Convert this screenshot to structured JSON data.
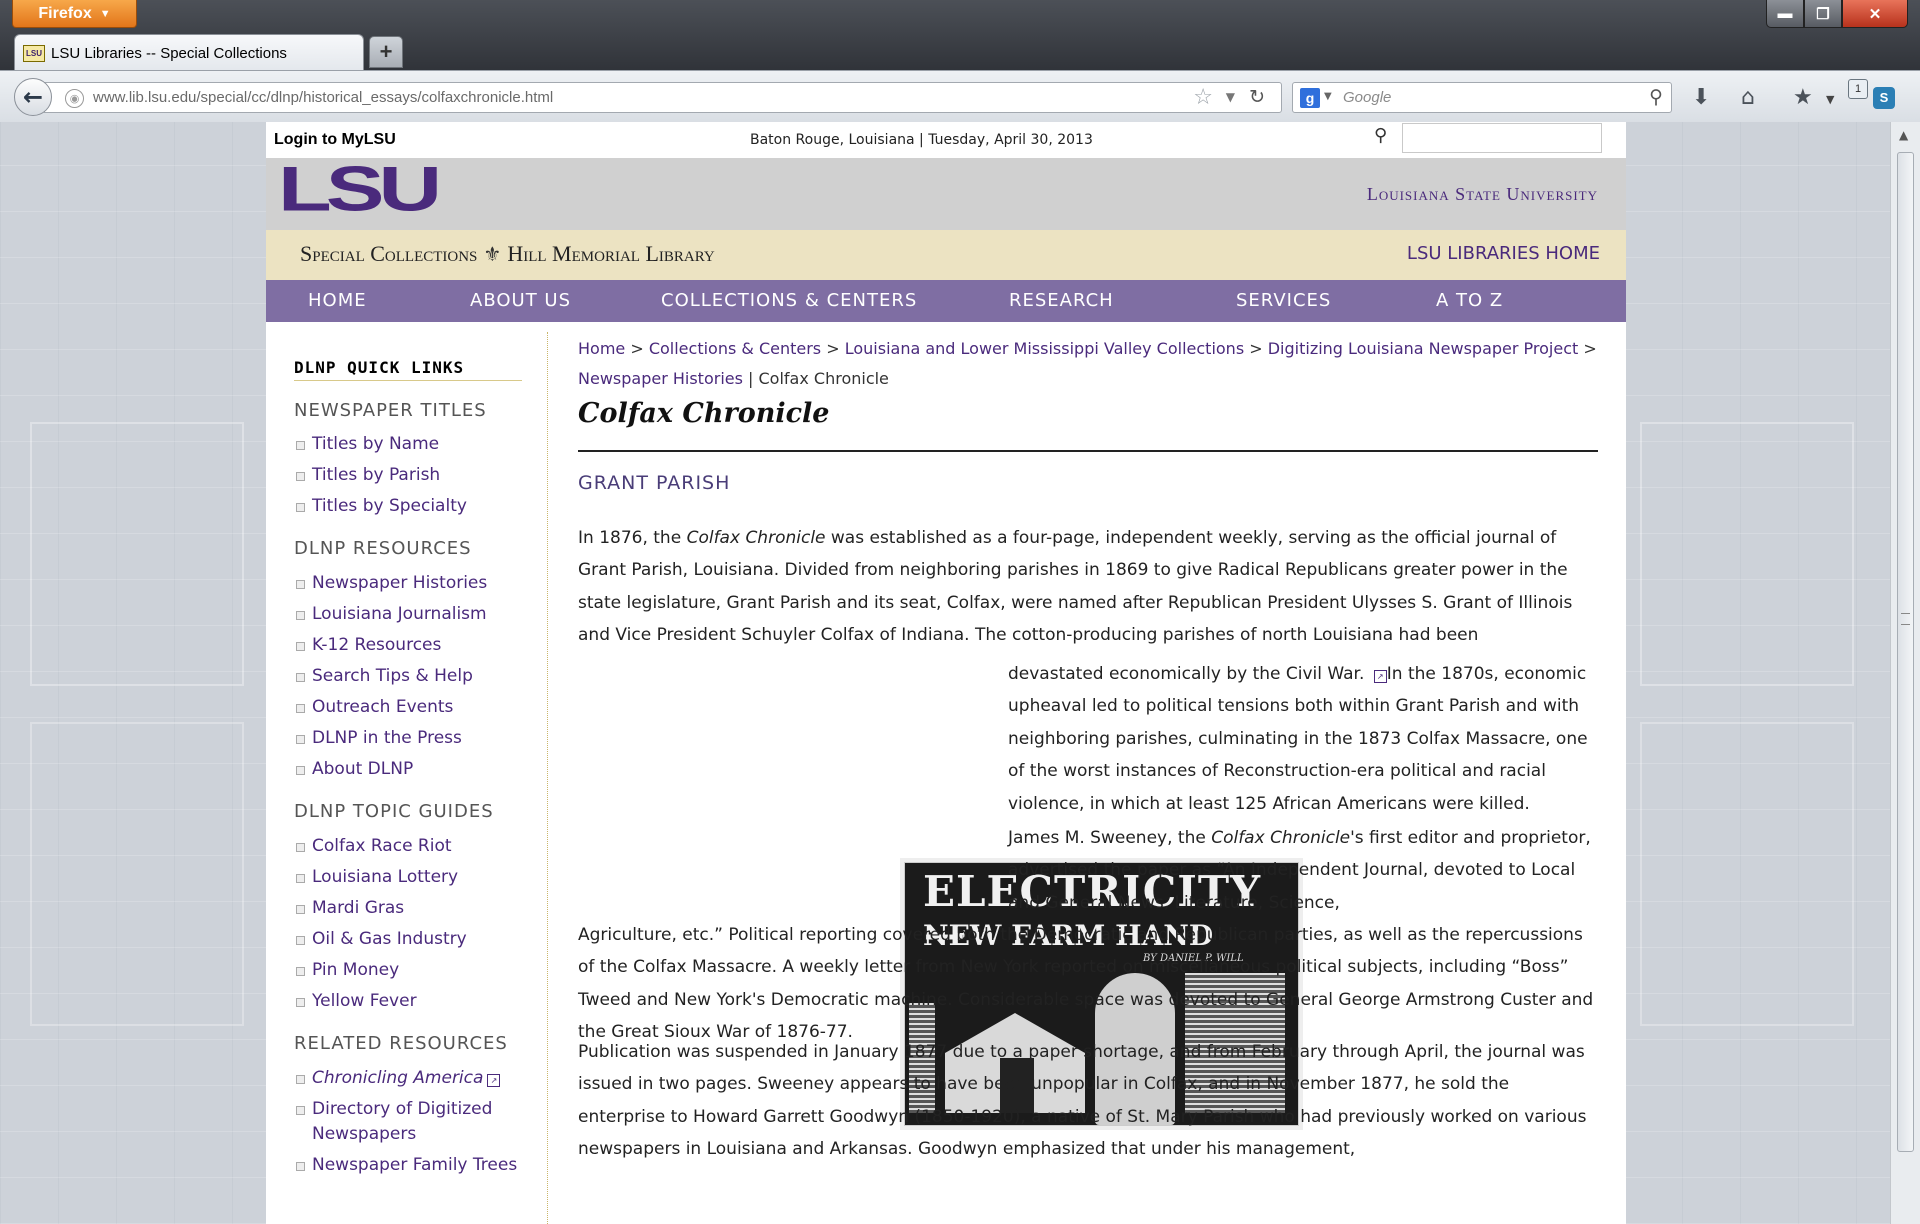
{
  "browser": {
    "menu_button": "Firefox",
    "tab_title": "LSU Libraries -- Special Collections",
    "tab_favicon": "LSU",
    "new_tab": "+",
    "url": "www.lib.lsu.edu/special/cc/dlnp/historical_essays/colfaxchronicle.html",
    "search_engine": "g",
    "search_placeholder": "Google",
    "addon_badge": "1",
    "addon_label": "S"
  },
  "header": {
    "login": "Login to MyLSU",
    "dateline": "Baton Rouge, Louisiana | Tuesday, April 30, 2013",
    "logo": "LSU",
    "university": "Louisiana State University",
    "special_collections": "Special Collections",
    "library_name": "Hill Memorial Library",
    "libraries_home": "LSU LIBRARIES HOME",
    "brand_color": "#4a2a7c",
    "nav_color": "#7f6ea3"
  },
  "nav": [
    "HOME",
    "ABOUT US",
    "COLLECTIONS & CENTERS",
    "RESEARCH",
    "SERVICES",
    "A TO Z"
  ],
  "sidebar": {
    "quick_links": "DLNP QUICK LINKS",
    "newspaper_titles": {
      "heading": "NEWSPAPER TITLES",
      "items": [
        "Titles by Name",
        "Titles by Parish",
        "Titles by Specialty"
      ]
    },
    "resources": {
      "heading": "DLNP RESOURCES",
      "items": [
        "Newspaper Histories",
        "Louisiana Journalism",
        "K-12 Resources",
        "Search Tips & Help",
        "Outreach Events",
        "DLNP in the Press",
        "About DLNP"
      ]
    },
    "topic_guides": {
      "heading": "DLNP TOPIC GUIDES",
      "items": [
        "Colfax Race Riot",
        "Louisiana Lottery",
        "Mardi Gras",
        "Oil & Gas Industry",
        "Pin Money",
        "Yellow Fever"
      ]
    },
    "related": {
      "heading": "RELATED RESOURCES",
      "items": [
        "Chronicling America",
        "Directory of Digitized Newspapers",
        "Newspaper Family Trees"
      ]
    }
  },
  "breadcrumb": {
    "items": [
      "Home",
      "Collections & Centers",
      "Louisiana and Lower Mississippi Valley Collections",
      "Digitizing Louisiana Newspaper Project",
      "Newspaper Histories"
    ],
    "current": "Colfax Chronicle"
  },
  "article": {
    "title": "Colfax Chronicle",
    "parish": "GRANT PARISH",
    "p1_a": "In 1876, the ",
    "p1_em": "Colfax Chronicle",
    "p1_b": " was established as a four-page, independent weekly, serving as the official journal of Grant Parish, Louisiana. Divided from neighboring parishes in 1869 to give Radical Republicans greater power in the state legislature, Grant Parish and its seat, Colfax, were named after Republican President Ulysses S. Grant of Illinois and Vice President Schuyler Colfax of Indiana. The cotton-producing parishes of north Louisiana had been",
    "p1_c": "devastated economically by the Civil War.",
    "p1_d": "In the 1870s, economic upheaval led to political tensions both within Grant Parish and with neighboring parishes, culminating in the 1873 Colfax Massacre, one of the worst instances of Reconstruction-era political and racial violence, in which at least 125 African Americans were killed.",
    "p2_a": "James M. Sweeney, the ",
    "p2_em": "Colfax Chronicle",
    "p2_b": "'s first editor and proprietor, advertised the paper as “An Independent Journal, devoted to Local and General News, Literature, Science,",
    "p2_c": "Agriculture, etc.” Political reporting covered both the Democratic and Republican parties, as well as the repercussions of the Colfax Massacre. A weekly letter from New York reported on miscellaneous political subjects, including “Boss” Tweed and New York's Democratic machine. Considerable space was devoted to General George Armstrong Custer and the Great Sioux War of 1876-77.",
    "p3": "Publication was suspended in January 1877 due to a paper shortage, and from February through April, the journal was issued in two pages. Sweeney appears to have been unpopular in Colfax, and in November 1877, he sold the enterprise to Howard Garrett Goodwyn (1850-1920), a native of St. Mary Parish who had previously worked on various newspapers in Louisiana and Arkansas. Goodwyn emphasized that under his management,",
    "image": {
      "headline": "ELECTRICITY—",
      "subhead": "NEW FARM HAND",
      "byline": "BY DANIEL P. WILL"
    }
  }
}
